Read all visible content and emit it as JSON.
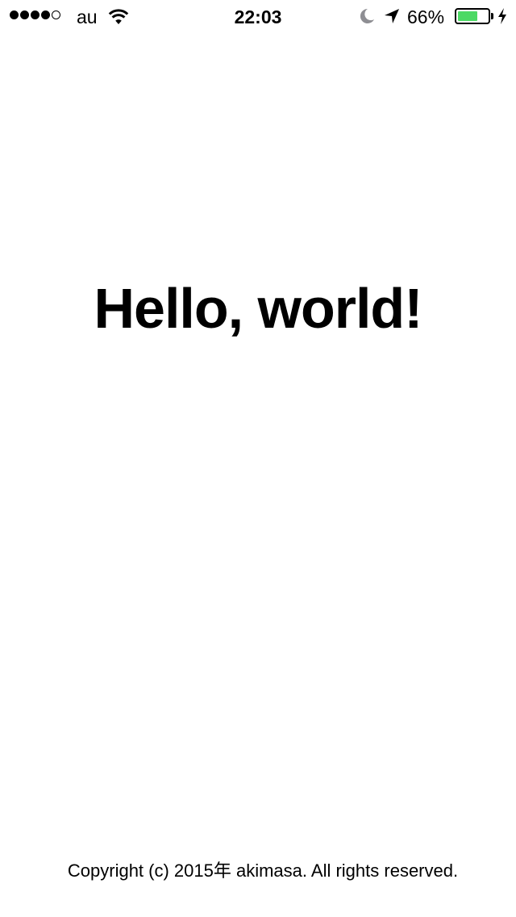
{
  "status_bar": {
    "signal_strength_bars": 4,
    "signal_total_bars": 5,
    "carrier": "au",
    "time": "22:03",
    "battery_percent": "66%",
    "battery_level": 0.66,
    "battery_fill_color": "#4cd964",
    "icons": [
      "signal-dots-icon",
      "wifi-icon",
      "moon-icon",
      "location-arrow-icon",
      "battery-icon",
      "charging-bolt-icon"
    ]
  },
  "main": {
    "greeting": "Hello, world!"
  },
  "footer": {
    "copyright": "Copyright (c) 2015年 akimasa. All rights reserved."
  }
}
